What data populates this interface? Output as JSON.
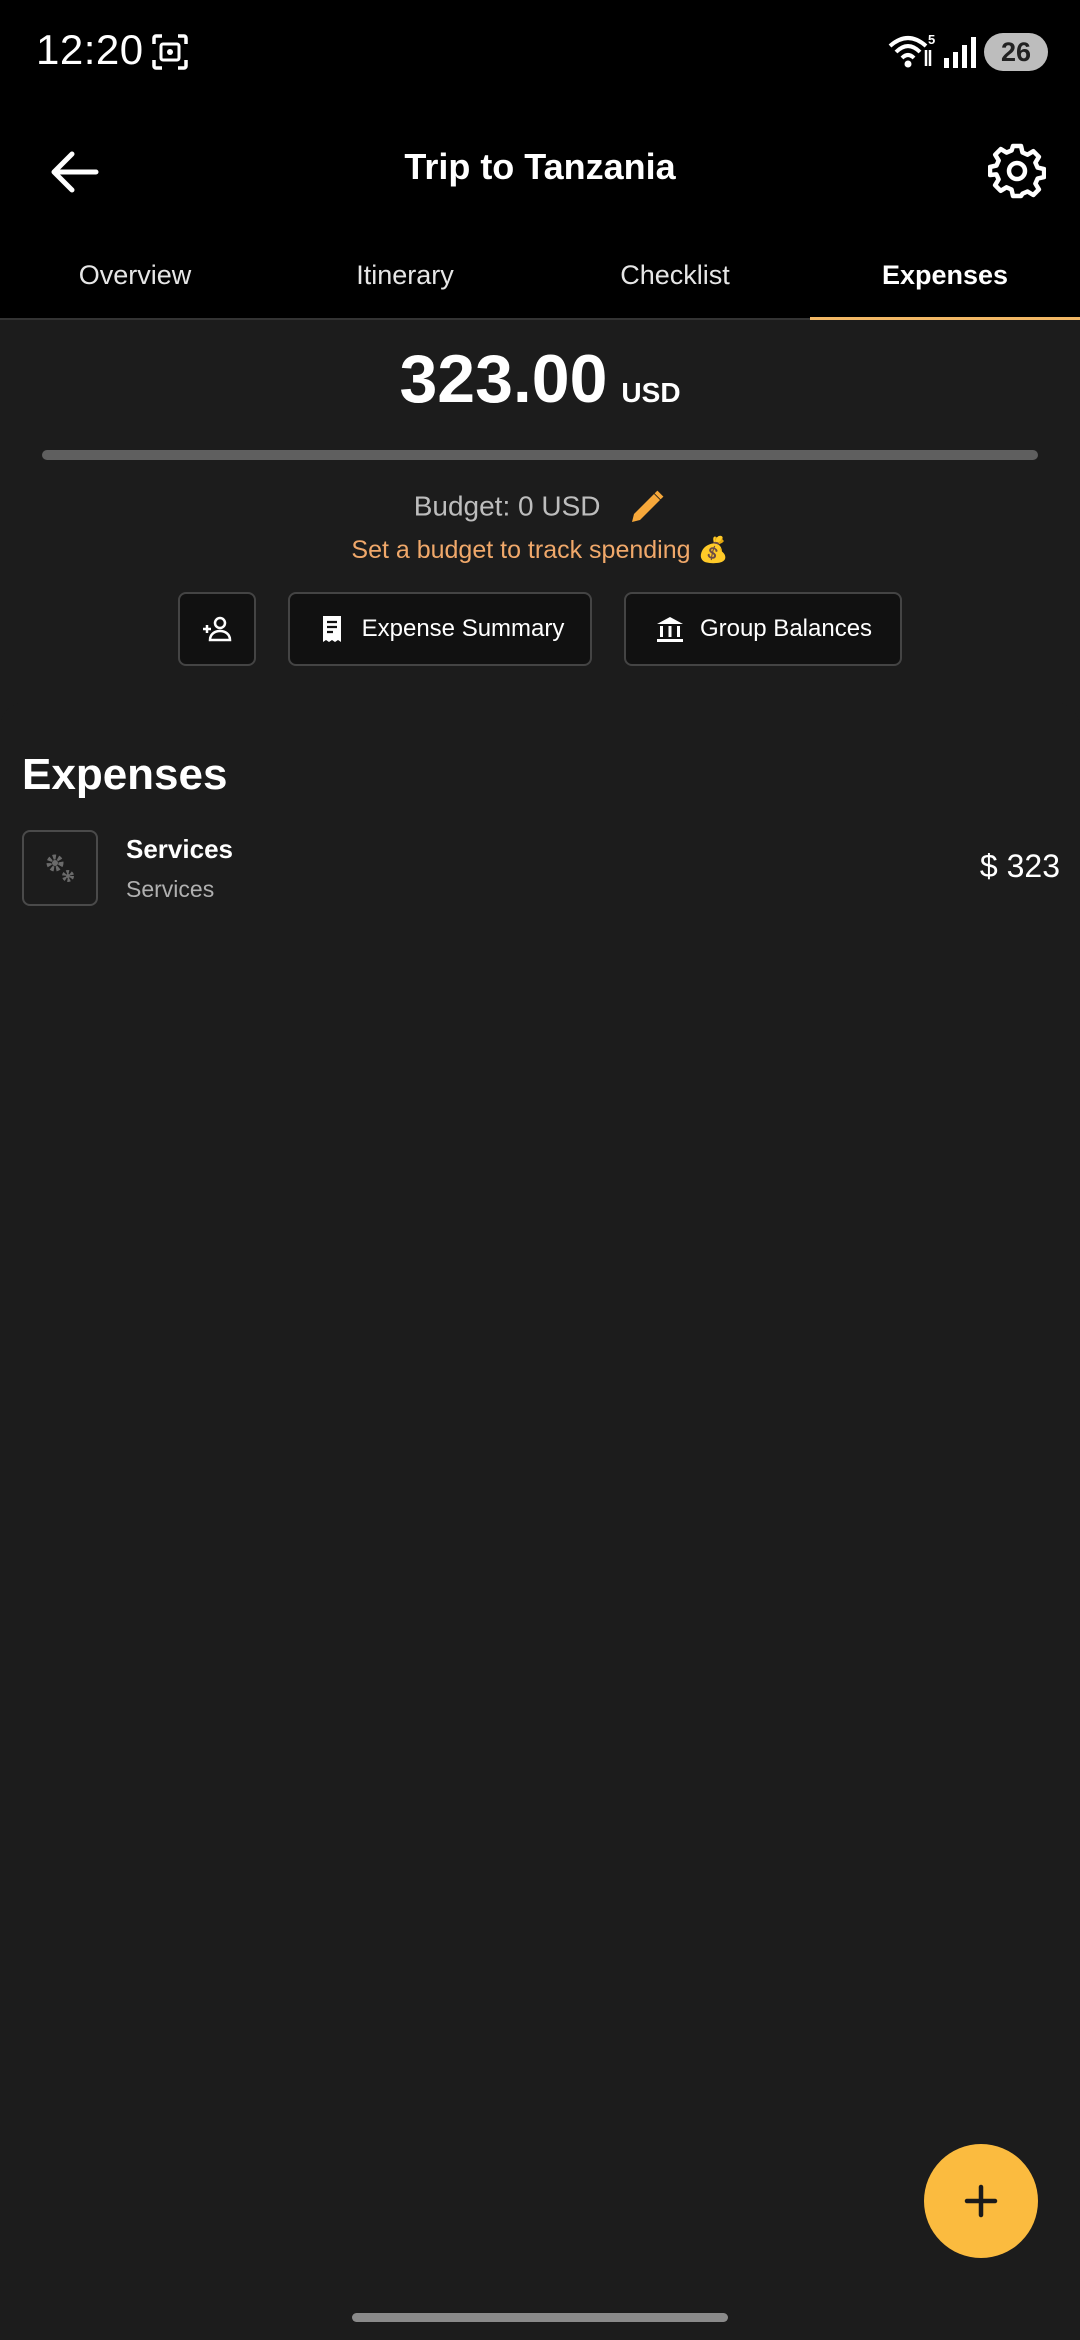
{
  "status_bar": {
    "time": "12:20",
    "wifi_badge": "5",
    "battery": "26",
    "icons": [
      "screenshot-icon",
      "wifi-icon",
      "signal-icon",
      "battery-icon"
    ]
  },
  "app_bar": {
    "title": "Trip to Tanzania",
    "back_icon": "arrow-left-icon",
    "settings_icon": "gear-icon"
  },
  "tabs": [
    {
      "label": "Overview",
      "active": false
    },
    {
      "label": "Itinerary",
      "active": false
    },
    {
      "label": "Checklist",
      "active": false
    },
    {
      "label": "Expenses",
      "active": true
    }
  ],
  "summary": {
    "total_amount": "323.00",
    "currency": "USD",
    "budget_label": "Budget: 0 USD",
    "budget_hint": "Set a budget to track spending 💰",
    "progress_percent": 0
  },
  "actions": {
    "add_member_icon": "person-add-icon",
    "expense_summary": "Expense Summary",
    "group_balances": "Group Balances"
  },
  "expenses": {
    "heading": "Expenses",
    "items": [
      {
        "title": "Services",
        "subtitle": "Services",
        "amount": "$ 323",
        "icon": "gears-icon"
      }
    ]
  },
  "fab": {
    "icon": "plus-icon"
  },
  "colors": {
    "accent": "#f2b866",
    "fab": "#fbbb3f",
    "hint": "#f0a86a",
    "background": "#1c1c1c",
    "header": "#000000"
  }
}
